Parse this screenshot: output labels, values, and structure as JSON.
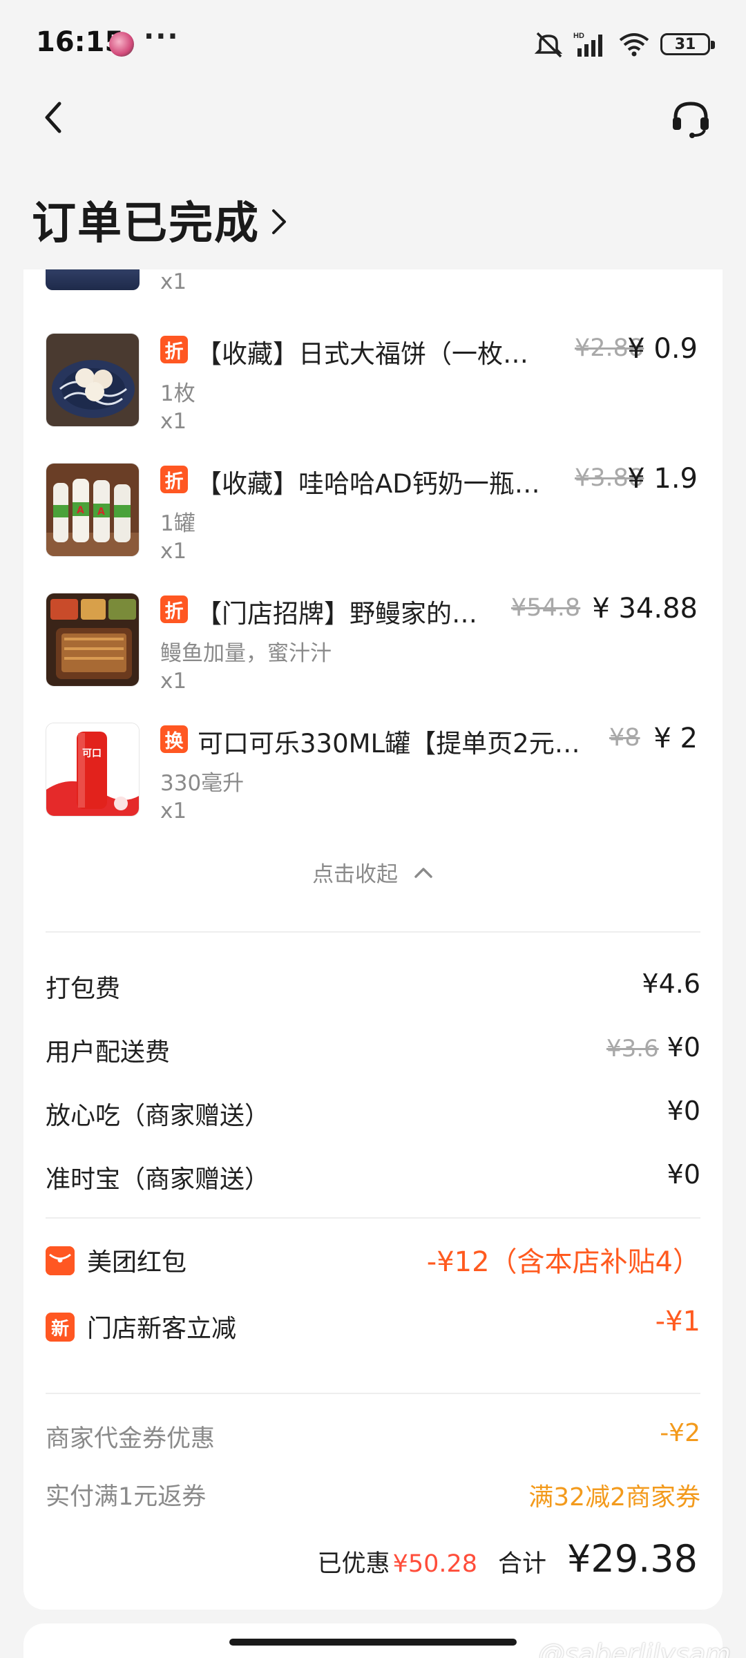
{
  "status_bar": {
    "time": "16:15",
    "more": "···",
    "battery": "31",
    "network": "HD"
  },
  "header": {
    "order_status": "订单已完成",
    "back_icon": "chevron-left-icon",
    "support_icon": "headset-icon"
  },
  "partial_item": {
    "qty": "x1"
  },
  "items": [
    {
      "badge": "折",
      "name": "【收藏】日式大福饼（一枚…",
      "original_price": "¥2.88",
      "price": "¥ 0.9",
      "spec": "1枚",
      "qty": "x1"
    },
    {
      "badge": "折",
      "name": "【收藏】哇哈哈AD钙奶一瓶…",
      "original_price": "¥3.88",
      "price": "¥ 1.9",
      "spec": "1罐",
      "qty": "x1"
    },
    {
      "badge": "折",
      "name": "【门店招牌】野鳗家的…",
      "original_price": "¥54.8",
      "price": "¥ 34.88",
      "spec": "鳗鱼加量，蜜汁汁",
      "qty": "x1"
    },
    {
      "badge": "换",
      "name": "可口可乐330ML罐【提单页2元…",
      "original_price": "¥8",
      "price": "¥ 2",
      "spec": "330毫升",
      "qty": "x1"
    }
  ],
  "collapse_label": "点击收起",
  "fees": [
    {
      "label": "打包费",
      "original": "",
      "value": "¥4.6"
    },
    {
      "label": "用户配送费",
      "original": "¥3.6",
      "value": "¥0"
    },
    {
      "label": "放心吃（商家赠送）",
      "original": "",
      "value": "¥0"
    },
    {
      "label": "准时宝（商家赠送）",
      "original": "",
      "value": "¥0"
    }
  ],
  "promotions": [
    {
      "icon": "red-envelope-icon",
      "icon_text": "",
      "label": "美团红包",
      "value": "-¥12（含本店补贴4）"
    },
    {
      "icon": "new-customer-icon",
      "icon_text": "新",
      "label": "门店新客立减",
      "value": "-¥1"
    }
  ],
  "coupons": [
    {
      "label": "商家代金券优惠",
      "value": "-¥2"
    },
    {
      "label": "实付满1元返券",
      "value": "满32减2商家券"
    }
  ],
  "summary": {
    "saved_label": "已优惠",
    "saved_value": "¥50.28",
    "total_label": "合计",
    "total_value": "¥29.38"
  },
  "watermark": "@saberlilysam",
  "colors": {
    "accent": "#ff5722",
    "discount_red": "#ff5a1f",
    "coupon_orange": "#f39a1c",
    "background": "#f4f4f4"
  }
}
